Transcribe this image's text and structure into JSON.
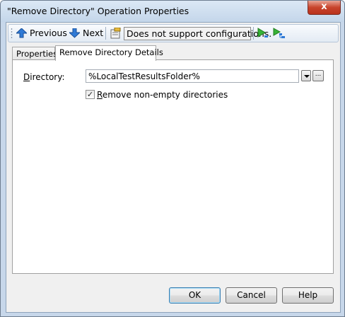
{
  "window": {
    "title": "\"Remove Directory\" Operation Properties",
    "close_label": "x"
  },
  "toolbar": {
    "previous_label": "Previous",
    "next_label": "Next",
    "configurations_text": "Does not support configurations.",
    "icons": [
      "arrow-up-icon",
      "arrow-down-icon",
      "properties-icon",
      "run-operation-icon",
      "run-tree-icon"
    ]
  },
  "tabs": [
    {
      "label": "Properties",
      "active": false
    },
    {
      "label": "Remove Directory Details",
      "active": true
    }
  ],
  "details": {
    "directory_label": "Directory:",
    "directory_value": "%LocalTestResultsFolder%",
    "more_button": "...",
    "remove_nonempty_label": "Remove non-empty directories",
    "remove_nonempty_checked": true
  },
  "buttons": {
    "ok": "OK",
    "cancel": "Cancel",
    "help": "Help"
  },
  "colors": {
    "accent_blue": "#1f6fc5",
    "run_green": "#2a9a2a"
  }
}
